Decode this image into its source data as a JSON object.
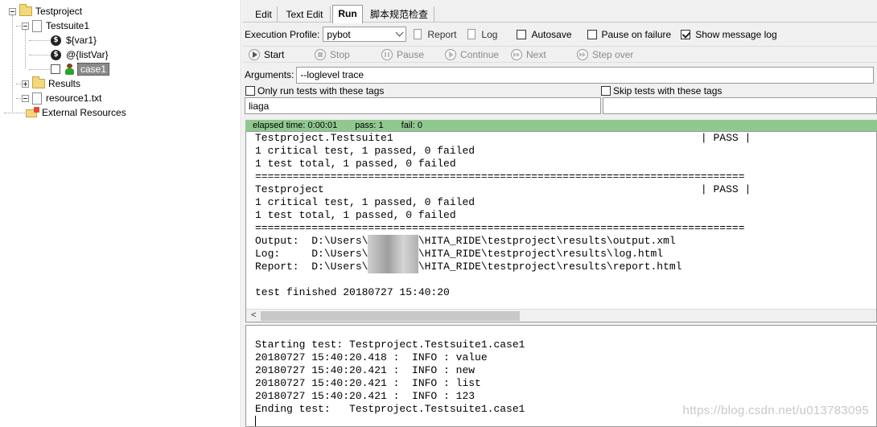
{
  "tree": {
    "project": "Testproject",
    "suite": "Testsuite1",
    "var1": "${var1}",
    "listvar": "@{listVar}",
    "testcase": "case1",
    "results": "Results",
    "resource": "resource1.txt",
    "external": "External Resources"
  },
  "tabs": [
    "Edit",
    "Text Edit",
    "Run",
    "脚本规范检查"
  ],
  "active_tab": "Run",
  "run": {
    "profile_label": "Execution Profile:",
    "profile_value": "pybot",
    "report_label": "Report",
    "log_label": "Log",
    "autosave_label": "Autosave",
    "autosave_checked": false,
    "pause_label": "Pause on failure",
    "pause_checked": false,
    "show_msg_label": "Show message log",
    "show_msg_checked": true
  },
  "toolbar": {
    "start": "Start",
    "stop": "Stop",
    "pause": "Pause",
    "continue": "Continue",
    "next": "Next",
    "step_over": "Step over"
  },
  "arguments": {
    "label": "Arguments:",
    "value": "--loglevel trace"
  },
  "tags": {
    "only_label": "Only run tests with these tags",
    "only_checked": false,
    "only_value": "liaga",
    "skip_label": "Skip tests with these tags",
    "skip_checked": false,
    "skip_value": ""
  },
  "status": {
    "elapsed": "elapsed time: 0:00:01",
    "pass": "pass: 1",
    "fail": "fail: 0",
    "color": "#90c890"
  },
  "output": {
    "suite_line": "Testproject.Testsuite1                                                 | PASS |",
    "critical1": "1 critical test, 1 passed, 0 failed",
    "total1": "1 test total, 1 passed, 0 failed",
    "sep": "==============================================================================",
    "project_line": "Testproject                                                            | PASS |",
    "critical2": "1 critical test, 1 passed, 0 failed",
    "total2": "1 test total, 1 passed, 0 failed",
    "sep2": "==============================================================================",
    "output_pre": "Output:  D:\\Users\\",
    "output_post": "\\HITA_RIDE\\testproject\\results\\output.xml",
    "log_pre": "Log:     D:\\Users\\",
    "log_post": "\\HITA_RIDE\\testproject\\results\\log.html",
    "report_pre": "Report:  D:\\Users\\",
    "report_post": "\\HITA_RIDE\\testproject\\results\\report.html",
    "finished": "test finished 20180727 15:40:20"
  },
  "message_log": [
    "Starting test: Testproject.Testsuite1.case1",
    "20180727 15:40:20.418 :  INFO : value",
    "20180727 15:40:20.421 :  INFO : new",
    "20180727 15:40:20.421 :  INFO : list",
    "20180727 15:40:20.421 :  INFO : 123",
    "Ending test:   Testproject.Testsuite1.case1"
  ],
  "watermark": "https://blog.csdn.net/u013783095"
}
